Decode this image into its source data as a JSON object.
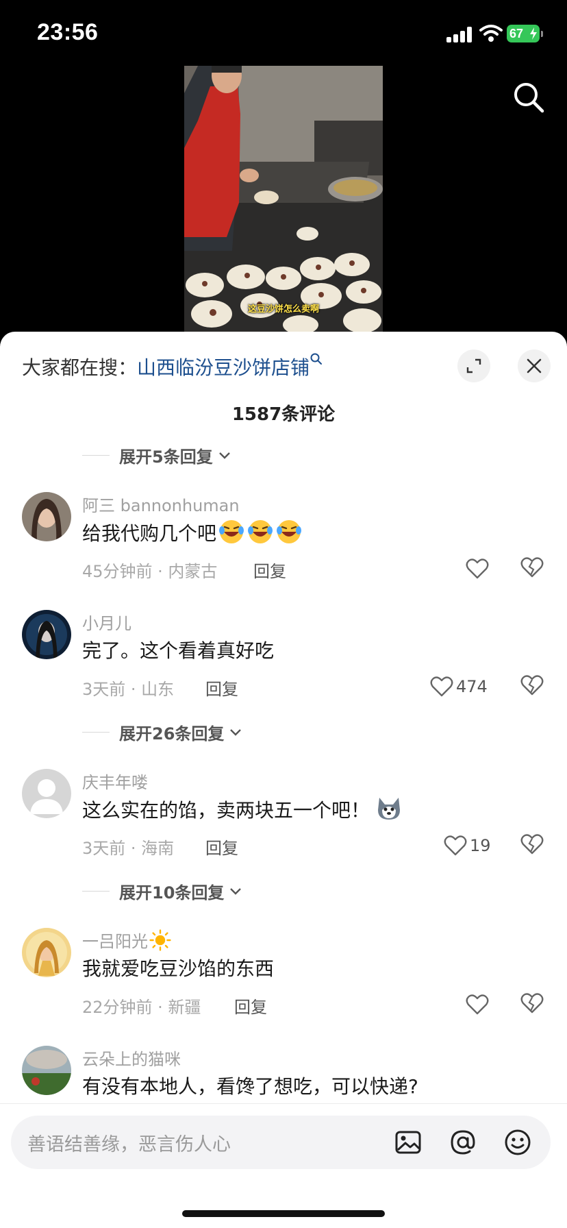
{
  "status_bar": {
    "time": "23:56",
    "battery": "67"
  },
  "video": {
    "caption": "这豆沙饼怎么卖啊"
  },
  "sheet": {
    "search_hint_label": "大家都在搜：",
    "search_hint_keyword": "山西临汾豆沙饼店铺",
    "comment_count": "1587条评论",
    "expand_top": "展开5条回复",
    "comments": [
      {
        "user": "阿三 bannonhuman",
        "text": "给我代购几个吧",
        "emoji": [
          "laughing-crying-emoji",
          "laughing-crying-emoji",
          "laughing-crying-emoji"
        ],
        "meta": "45分钟前 · 内蒙古",
        "reply": "回复",
        "likes": ""
      },
      {
        "user": "小月儿",
        "text": "完了。这个看着真好吃",
        "meta": "3天前 · 山东",
        "reply": "回复",
        "likes": "474"
      },
      {
        "user": "庆丰年喽",
        "text": "这么实在的馅，卖两块五一个吧！",
        "emoji": [
          "husky-emoji"
        ],
        "meta": "3天前 · 海南",
        "reply": "回复",
        "likes": "19"
      },
      {
        "user": "一吕阳光",
        "user_emoji": "sun-emoji",
        "text": "我就爱吃豆沙馅的东西",
        "meta": "22分钟前 · 新疆",
        "reply": "回复",
        "likes": ""
      },
      {
        "user": "云朵上的猫咪",
        "text": "有没有本地人，看馋了想吃，可以快递?"
      }
    ],
    "expand_after_1": "展开26条回复",
    "expand_after_2": "展开10条回复"
  },
  "input": {
    "placeholder": "善语结善缘，恶言伤人心"
  },
  "colors": {
    "keyword": "#1d4f8e",
    "battery": "#35c759",
    "gray_text": "#a0a0a0"
  }
}
